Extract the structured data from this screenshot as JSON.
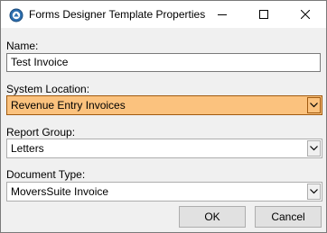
{
  "window": {
    "title": "Forms Designer Template Properties",
    "icon": "app-icon"
  },
  "fields": {
    "name": {
      "label": "Name:",
      "value": "Test Invoice"
    },
    "system_location": {
      "label": "System Location:",
      "value": "Revenue Entry Invoices",
      "highlight_color": "#fbc27e"
    },
    "report_group": {
      "label": "Report Group:",
      "value": "Letters"
    },
    "document_type": {
      "label": "Document Type:",
      "value": "MoversSuite Invoice"
    }
  },
  "buttons": {
    "ok": "OK",
    "cancel": "Cancel"
  }
}
